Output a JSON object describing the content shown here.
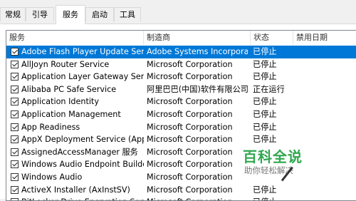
{
  "tabs": [
    "常规",
    "引导",
    "服务",
    "启动",
    "工具"
  ],
  "active_tab": "服务",
  "columns": [
    "服务",
    "制造商",
    "状态",
    "禁用日期"
  ],
  "rows": [
    {
      "name": "Adobe Flash Player Update Servi...",
      "maker": "Adobe Systems Incorporat...",
      "status": "已停止",
      "checked": true,
      "selected": true
    },
    {
      "name": "AllJoyn Router Service",
      "maker": "Microsoft Corporation",
      "status": "已停止",
      "checked": true
    },
    {
      "name": "Application Layer Gateway Service",
      "maker": "Microsoft Corporation",
      "status": "已停止",
      "checked": true
    },
    {
      "name": "Alibaba PC Safe Service",
      "maker": "阿里巴巴(中国)软件有限公司",
      "status": "正在运行",
      "checked": true
    },
    {
      "name": "Application Identity",
      "maker": "Microsoft Corporation",
      "status": "已停止",
      "checked": true
    },
    {
      "name": "Application Management",
      "maker": "Microsoft Corporation",
      "status": "已停止",
      "checked": true
    },
    {
      "name": "App Readiness",
      "maker": "Microsoft Corporation",
      "status": "已停止",
      "checked": true
    },
    {
      "name": "AppX Deployment Service (AppX...",
      "maker": "Microsoft Corporation",
      "status": "已停止",
      "checked": true
    },
    {
      "name": "AssignedAccessManager 服务",
      "maker": "Microsoft Corporation",
      "status": "",
      "checked": true
    },
    {
      "name": "Windows Audio Endpoint Builder",
      "maker": "Microsoft Corporation",
      "status": "",
      "checked": true
    },
    {
      "name": "Windows Audio",
      "maker": "Microsoft Corporation",
      "status": "",
      "checked": true
    },
    {
      "name": "ActiveX Installer (AxInstSV)",
      "maker": "Microsoft Corporation",
      "status": "已停止",
      "checked": true
    },
    {
      "name": "BitLocker Drive Encryption Service",
      "maker": "Microsoft Corporation",
      "status": "已停止",
      "checked": true
    }
  ],
  "watermark": {
    "title": "百科全说",
    "subtitle": "助你轻松解决"
  }
}
